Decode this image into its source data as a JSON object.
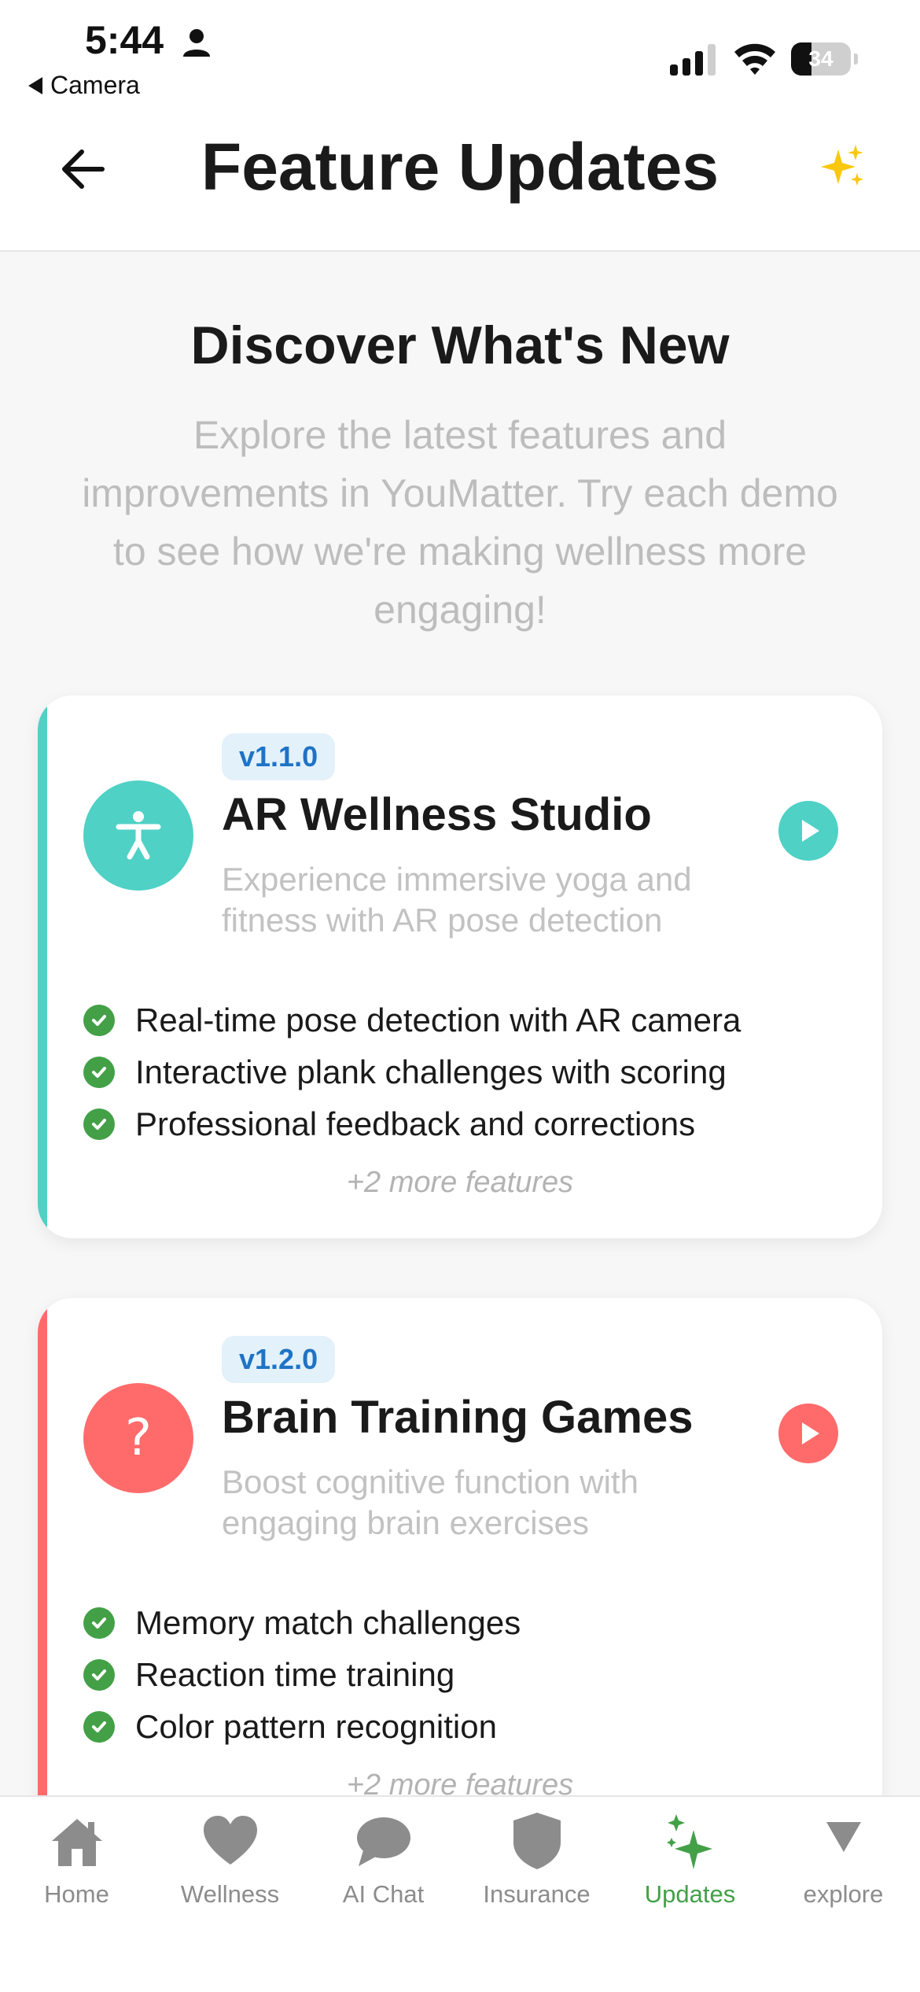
{
  "status_bar": {
    "time": "5:44",
    "back_app": "Camera",
    "battery_percent": 34
  },
  "header": {
    "title": "Feature Updates"
  },
  "intro": {
    "title": "Discover What's New",
    "text": "Explore the latest features and improvements in YouMatter. Try each demo to see how we're making wellness more engaging!"
  },
  "cards": [
    {
      "version": "v1.1.0",
      "title": "AR Wellness Studio",
      "description": "Experience immersive yoga and fitness with AR pose detection",
      "accent_color": "#4fd1c5",
      "icon": "accessibility-icon",
      "features": [
        "Real-time pose detection with AR camera",
        "Interactive plank challenges with scoring",
        "Professional feedback and corrections"
      ],
      "more": "+2 more features"
    },
    {
      "version": "v1.2.0",
      "title": "Brain Training Games",
      "description": "Boost cognitive function with engaging brain exercises",
      "accent_color": "#ff6b6b",
      "icon": "question-icon",
      "icon_text": "?",
      "features": [
        "Memory match challenges",
        "Reaction time training",
        "Color pattern recognition"
      ],
      "more": "+2 more features"
    }
  ],
  "tabs": [
    {
      "label": "Home",
      "icon": "home-icon",
      "active": false
    },
    {
      "label": "Wellness",
      "icon": "heart-icon",
      "active": false
    },
    {
      "label": "AI Chat",
      "icon": "chat-bubble-icon",
      "active": false
    },
    {
      "label": "Insurance",
      "icon": "shield-icon",
      "active": false
    },
    {
      "label": "Updates",
      "icon": "sparkles-icon",
      "active": true
    },
    {
      "label": "explore",
      "icon": "triangle-down-icon",
      "active": false
    }
  ],
  "colors": {
    "active_tab": "#43a047",
    "inactive_tab": "#8c8c8c",
    "check": "#43a047",
    "version_badge_text": "#1f73c4"
  }
}
